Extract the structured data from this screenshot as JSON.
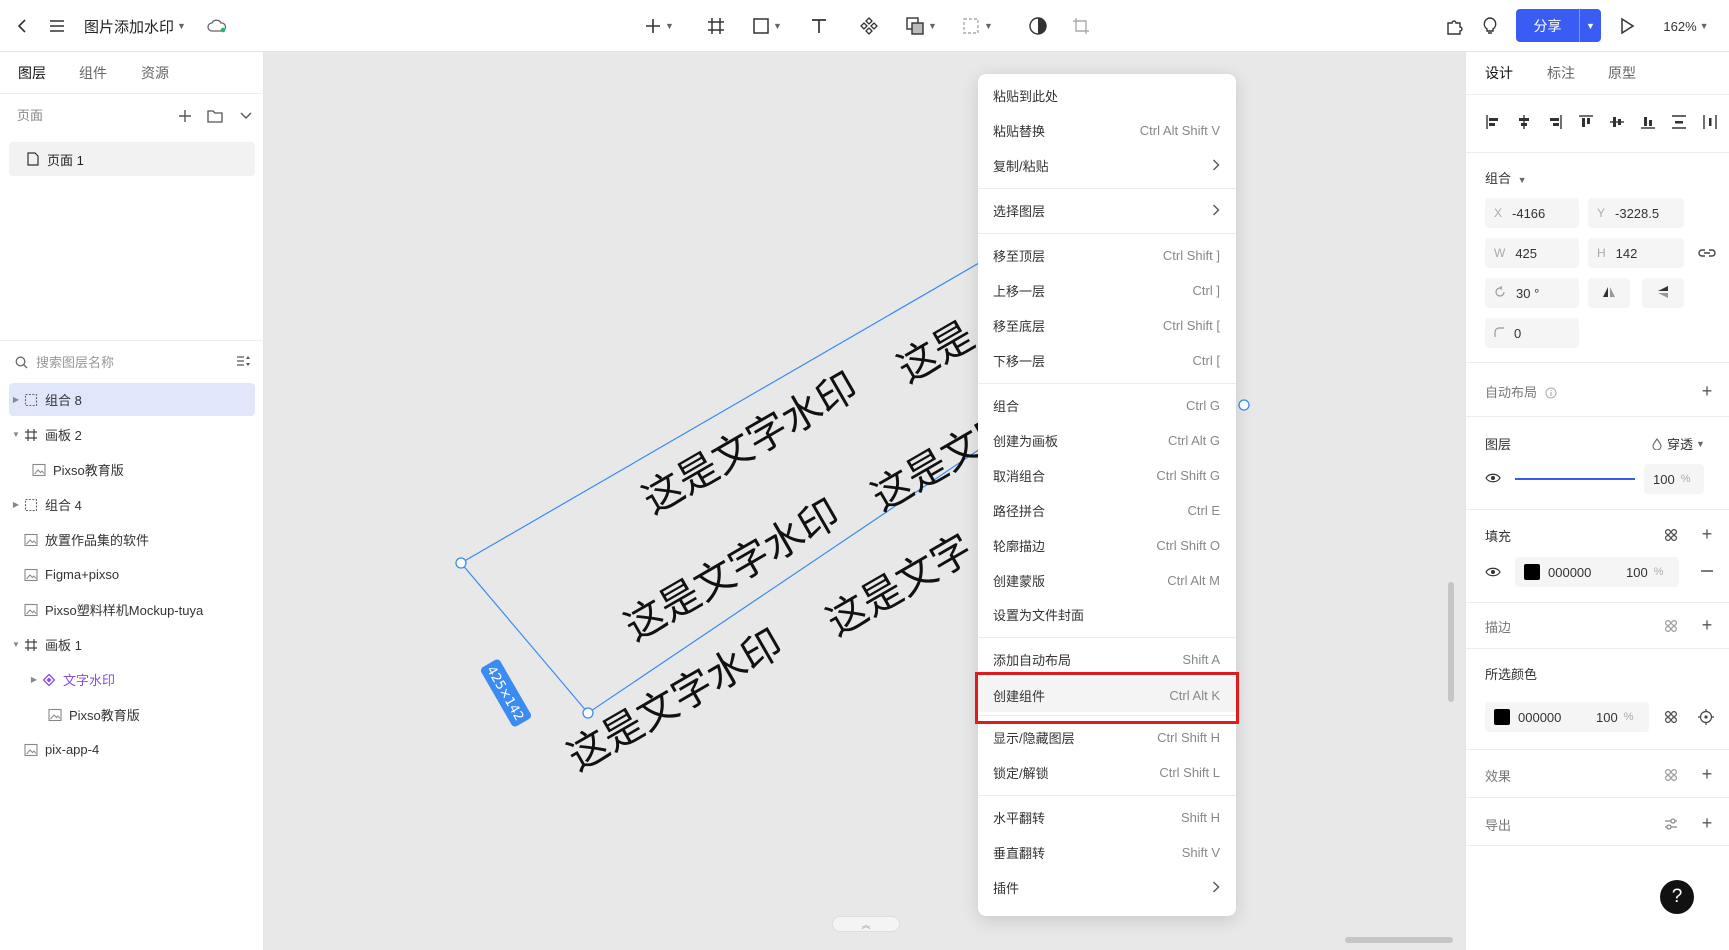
{
  "topbar": {
    "doc_title": "图片添加水印",
    "share_label": "分享",
    "zoom": "162%"
  },
  "left_panel": {
    "tabs": [
      {
        "label": "图层"
      },
      {
        "label": "组件"
      },
      {
        "label": "资源"
      }
    ],
    "pages_label": "页面",
    "pages": [
      {
        "label": "页面 1"
      }
    ],
    "search_placeholder": "搜索图层名称",
    "layers": [
      {
        "label": "组合 8",
        "kind": "group"
      },
      {
        "label": "画板 2",
        "kind": "frame"
      },
      {
        "label": "Pixso教育版",
        "kind": "image"
      },
      {
        "label": "组合 4",
        "kind": "group"
      },
      {
        "label": "放置作品集的软件",
        "kind": "image"
      },
      {
        "label": "Figma+pixso",
        "kind": "image"
      },
      {
        "label": "Pixso塑料样机Mockup-tuya",
        "kind": "image"
      },
      {
        "label": "画板 1",
        "kind": "frame"
      },
      {
        "label": "文字水印",
        "kind": "component"
      },
      {
        "label": "Pixso教育版",
        "kind": "image"
      },
      {
        "label": "pix-app-4",
        "kind": "image"
      }
    ]
  },
  "canvas": {
    "watermark_text": "这是文字水印",
    "partial_text": "这是文字",
    "partial_text_short": "这是",
    "selection_size": "425×142",
    "selection_color": "#3b8bf0"
  },
  "context_menu": {
    "items": [
      {
        "label": "粘贴到此处",
        "shortcut": ""
      },
      {
        "label": "粘贴替换",
        "shortcut": "Ctrl Alt Shift V"
      },
      {
        "label": "复制/粘贴",
        "shortcut": ""
      },
      {
        "label": "选择图层",
        "shortcut": ""
      },
      {
        "label": "移至顶层",
        "shortcut": "Ctrl Shift ]"
      },
      {
        "label": "上移一层",
        "shortcut": "Ctrl ]"
      },
      {
        "label": "移至底层",
        "shortcut": "Ctrl Shift ["
      },
      {
        "label": "下移一层",
        "shortcut": "Ctrl ["
      },
      {
        "label": "组合",
        "shortcut": "Ctrl G"
      },
      {
        "label": "创建为画板",
        "shortcut": "Ctrl Alt G"
      },
      {
        "label": "取消组合",
        "shortcut": "Ctrl Shift G"
      },
      {
        "label": "路径拼合",
        "shortcut": "Ctrl E"
      },
      {
        "label": "轮廓描边",
        "shortcut": "Ctrl Shift O"
      },
      {
        "label": "创建蒙版",
        "shortcut": "Ctrl Alt M"
      },
      {
        "label": "设置为文件封面",
        "shortcut": ""
      },
      {
        "label": "添加自动布局",
        "shortcut": "Shift A"
      },
      {
        "label": "创建组件",
        "shortcut": "Ctrl Alt K"
      },
      {
        "label": "显示/隐藏图层",
        "shortcut": "Ctrl Shift H"
      },
      {
        "label": "锁定/解锁",
        "shortcut": "Ctrl Shift L"
      },
      {
        "label": "水平翻转",
        "shortcut": "Shift H"
      },
      {
        "label": "垂直翻转",
        "shortcut": "Shift V"
      },
      {
        "label": "插件",
        "shortcut": ""
      }
    ],
    "highlight_color": "#e01b1b"
  },
  "right_panel": {
    "tabs": [
      {
        "label": "设计"
      },
      {
        "label": "标注"
      },
      {
        "label": "原型"
      }
    ],
    "group_label": "组合",
    "x_label": "X",
    "x_value": "-4166",
    "y_label": "Y",
    "y_value": "-3228.5",
    "w_label": "W",
    "w_value": "425",
    "h_label": "H",
    "h_value": "142",
    "rotation": "30 °",
    "radius": "0",
    "auto_layout": "自动布局",
    "layer_label": "图层",
    "blend_mode": "穿透",
    "opacity": "100",
    "opacity_fraction": 1.0,
    "percent": "%",
    "fill_label": "填充",
    "fill_color": "000000",
    "fill_opacity": "100",
    "stroke_label": "描边",
    "selected_colors_label": "所选颜色",
    "sel_color": "000000",
    "sel_opacity": "100",
    "effects_label": "效果",
    "export_label": "导出",
    "accent": "#3b5cf4"
  },
  "help_label": "?"
}
